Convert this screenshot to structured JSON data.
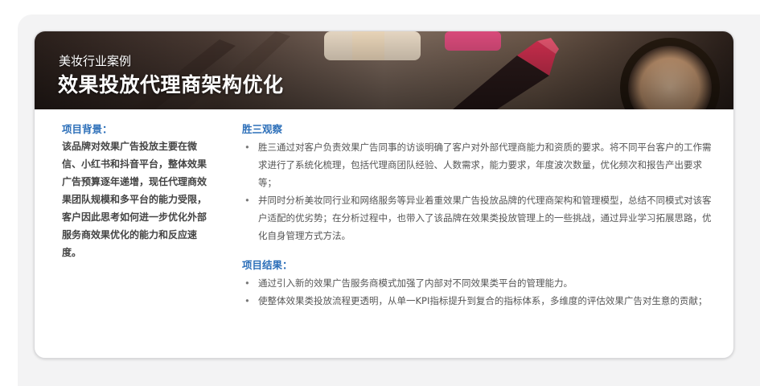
{
  "banner": {
    "subtitle": "美妆行业案例",
    "title": "效果投放代理商架构优化"
  },
  "background": {
    "label": "项目背景：",
    "text": "该品牌对效果广告投放主要在微信、小红书和抖音平台，整体效果广告预算逐年递增，现任代理商效果团队规模和多平台的能力受限，客户因此思考如何进一步优化外部服务商效果优化的能力和反应速度。"
  },
  "observation": {
    "label": "胜三观察",
    "items": [
      "胜三通过对客户负责效果广告同事的访谈明确了客户对外部代理商能力和资质的要求。将不同平台客户的工作需求进行了系统化梳理，包括代理商团队经验、人数需求，能力要求，年度波次数量，优化频次和报告产出要求等；",
      "并同时分析美妆同行业和网络服务等异业着重效果广告投放品牌的代理商架构和管理模型，总结不同模式对该客户适配的优劣势；在分析过程中，也带入了该品牌在效果类投放管理上的一些挑战，通过异业学习拓展思路，优化自身管理方式方法。"
    ]
  },
  "results": {
    "label": "项目结果：",
    "items": [
      "通过引入新的效果广告服务商模式加强了内部对不同效果类平台的管理能力。",
      "使整体效果类投放流程更透明，从单一KPI指标提升到复合的指标体系，多维度的评估效果广告对生意的贡献；"
    ]
  },
  "colors": {
    "accent": "#2c6fb9",
    "body_text": "#555555",
    "panel_bg": "#f3f3f4"
  }
}
